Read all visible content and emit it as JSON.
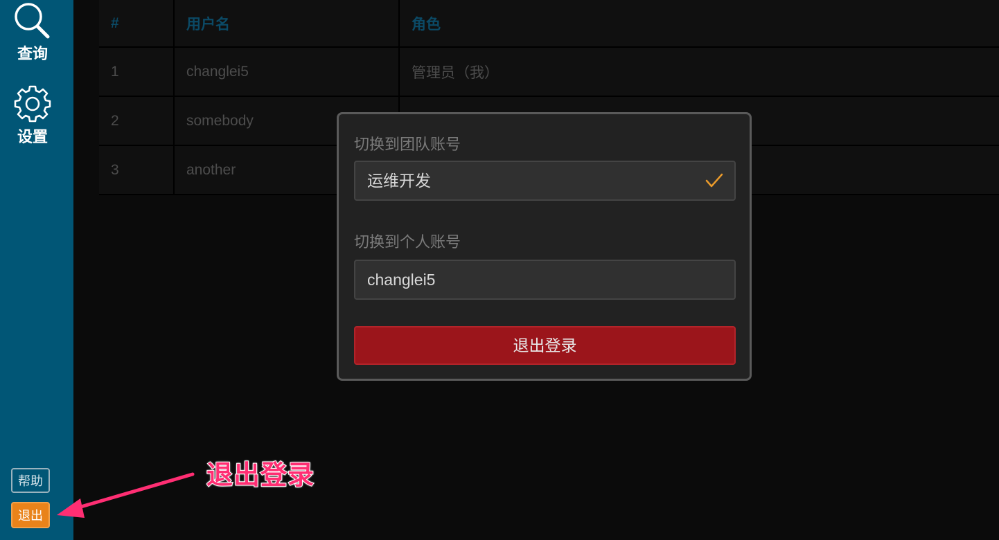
{
  "sidebar": {
    "query_label": "查询",
    "settings_label": "设置",
    "help_label": "帮助",
    "logout_label": "退出",
    "query_icon": "search-icon",
    "settings_icon": "gear-icon",
    "bg_color": "#015676"
  },
  "table": {
    "headers": [
      "#",
      "用户名",
      "角色"
    ],
    "rows": [
      {
        "idx": "1",
        "user": "changlei5",
        "role": "管理员（我）"
      },
      {
        "idx": "2",
        "user": "somebody",
        "role": ""
      },
      {
        "idx": "3",
        "user": "another",
        "role": ""
      }
    ]
  },
  "popup": {
    "team_label": "切换到团队账号",
    "team_value": "运维开发",
    "team_check_icon": "checkmark-icon",
    "personal_label": "切换到个人账号",
    "personal_value": "changlei5",
    "signout_label": "退出登录",
    "signout_color": "#9b151b",
    "check_color": "#e99a2b"
  },
  "annotation": {
    "text": "退出登录",
    "color": "#ff2e73"
  }
}
